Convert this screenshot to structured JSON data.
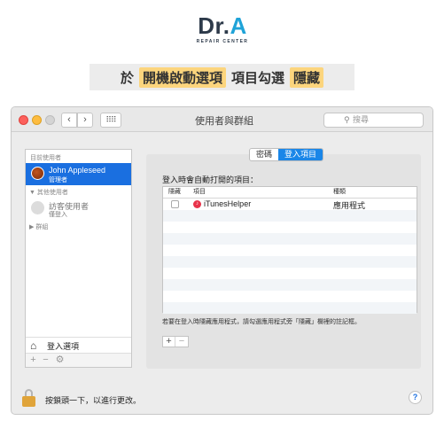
{
  "brand": {
    "logo_main": "Dr.",
    "logo_accent": "A",
    "logo_sub": "REPAIR CENTER"
  },
  "banner": {
    "parts": [
      "於",
      "開機啟動選項",
      "項目勾選",
      "隱藏"
    ]
  },
  "window": {
    "title": "使用者與群組",
    "search_placeholder": "搜尋",
    "nav_back": "‹",
    "nav_forward": "›",
    "grid_icon": "⠿⠿"
  },
  "sidebar": {
    "current_header": "目前使用者",
    "current_user": {
      "name": "John Appleseed",
      "role": "管理者"
    },
    "other_header": "其他使用者",
    "guest_user": {
      "name": "訪客使用者",
      "status": "僅登入"
    },
    "groups_label": "群組",
    "login_options": "登入選項",
    "tools": [
      "+",
      "−",
      "⚙"
    ]
  },
  "tabs": [
    {
      "label": "密碼",
      "active": false
    },
    {
      "label": "登入項目",
      "active": true
    }
  ],
  "login_items": {
    "title": "登入時會自動打開的項目：",
    "columns": [
      "隱藏",
      "項目",
      "種類"
    ],
    "rows": [
      {
        "hidden": false,
        "item": "iTunesHelper",
        "kind": "應用程式"
      }
    ],
    "hint": "若要在登入時隱藏應用程式，請勾選應用程式旁「隱藏」欄裡的註記框。",
    "add_label": "+",
    "remove_label": "−"
  },
  "footer": {
    "lock_text": "按鎖頭一下，以進行更改。",
    "help_label": "?"
  },
  "colors": {
    "selection": "#1a6fe0",
    "tab_active": "#1a86e8",
    "highlight": "#fcd57d",
    "lock": "#e0a43a"
  }
}
